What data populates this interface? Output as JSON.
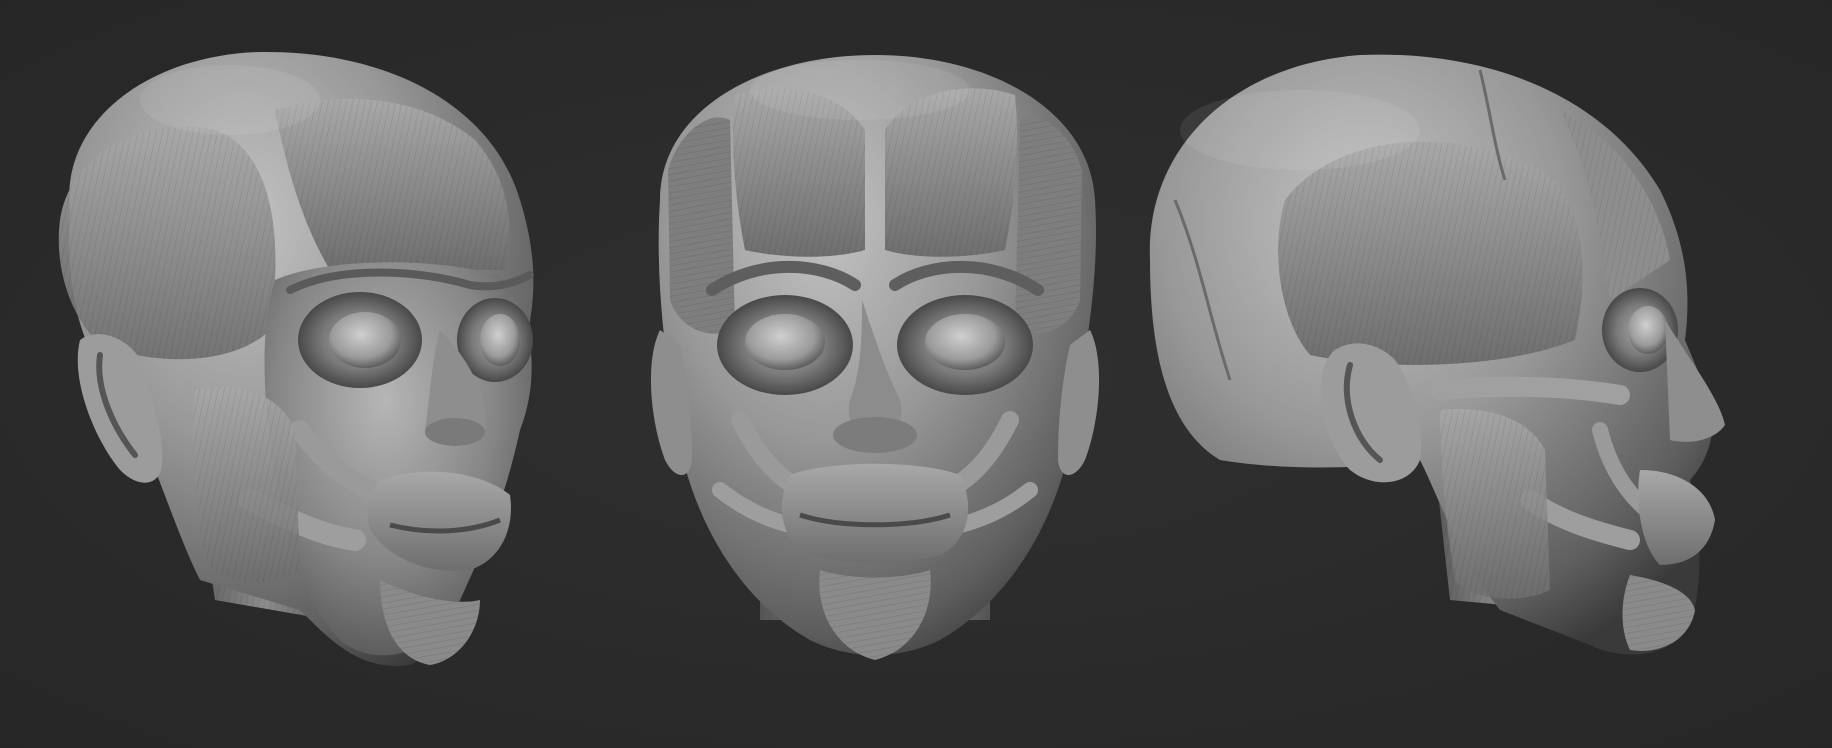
{
  "scene": {
    "subject": "ecorche-head-sculpt",
    "views": [
      {
        "view": "three-quarter"
      },
      {
        "view": "front"
      },
      {
        "view": "side-profile"
      }
    ]
  },
  "colors": {
    "background": "#2b2b2b",
    "clay_light": "#b8b8b8",
    "clay_mid": "#8a8a8a",
    "clay_dark": "#4a4a4a",
    "shadow": "#1c1c1c"
  }
}
